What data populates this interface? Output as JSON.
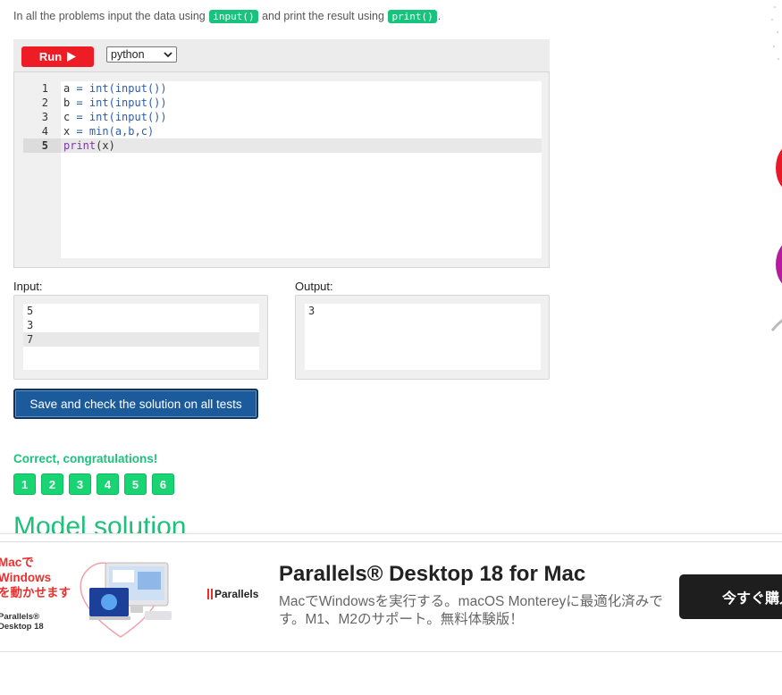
{
  "intro": {
    "prefix": "In all the problems input the data using",
    "input_code": "input()",
    "middle": "and print the result using",
    "print_code": "print()",
    "suffix": "."
  },
  "toolbar": {
    "run_label": "Run",
    "language_selected": "python"
  },
  "editor": {
    "line_numbers": [
      "1",
      "2",
      "3",
      "4",
      "5"
    ],
    "lines": [
      [
        "a",
        " = ",
        "int(input())"
      ],
      [
        "b",
        " = ",
        "int(input())"
      ],
      [
        "c",
        " = ",
        "int(input())"
      ],
      [
        "x",
        " = ",
        "min(a,b,c)"
      ],
      [
        "print",
        "(x)",
        ""
      ]
    ],
    "active_line": "5"
  },
  "input_panel": {
    "label": "Input:",
    "lines": [
      "5",
      "3",
      "7"
    ]
  },
  "output_panel": {
    "label": "Output:",
    "lines": [
      "3"
    ]
  },
  "save_button_label": "Save and check the solution on all tests",
  "result": {
    "message": "Correct, congratulations!",
    "tests": [
      "1",
      "2",
      "3",
      "4",
      "5",
      "6"
    ],
    "status_color": "#19d473"
  },
  "model_solution_heading": "Model solution",
  "ad": {
    "left_text_lines": [
      "Macで",
      "Windows",
      "を動かせます"
    ],
    "left_brand_lines": [
      "Parallels®",
      "Desktop 18"
    ],
    "logo_text": "Parallels",
    "title": "Parallels® Desktop 18 for Mac",
    "description": "MacでWindowsを実行する。macOS Montereyに最適化済みです。M1、M2のサポート。無料体験版！",
    "cta_label": "今すぐ購入"
  },
  "colors": {
    "run_button": "#ee1c25",
    "save_button": "#1c5b9b",
    "success_green": "#1dc17b"
  }
}
